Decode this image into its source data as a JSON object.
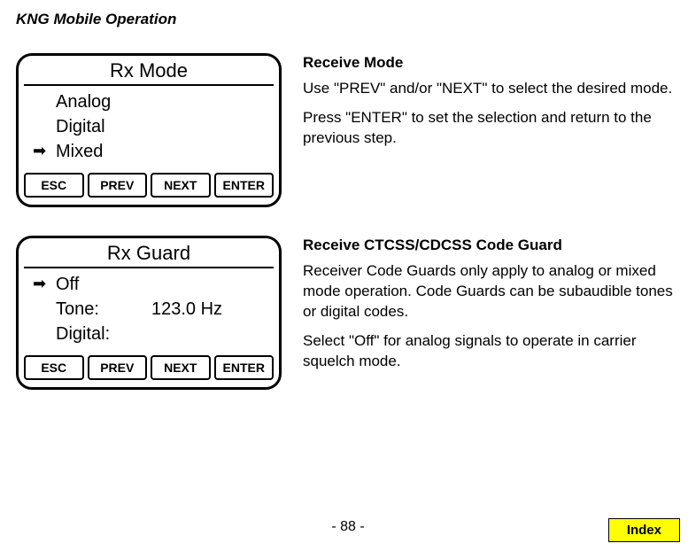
{
  "header": "KNG Mobile Operation",
  "section1": {
    "box": {
      "title": "Rx Mode",
      "items": [
        {
          "selected": false,
          "label": "Analog"
        },
        {
          "selected": false,
          "label": "Digital"
        },
        {
          "selected": true,
          "label": "Mixed"
        }
      ],
      "buttons": {
        "esc": "ESC",
        "prev": "PREV",
        "next": "NEXT",
        "enter": "ENTER"
      }
    },
    "desc": {
      "title": "Receive Mode",
      "p1": "Use \"PREV\" and/or \"NEXT\" to select the desired mode.",
      "p2": "Press \"ENTER\" to set the selection and return to the previous step."
    }
  },
  "section2": {
    "box": {
      "title": "Rx Guard",
      "items": [
        {
          "selected": true,
          "label": "Off",
          "value": ""
        },
        {
          "selected": false,
          "label": "Tone:",
          "value": "123.0 Hz"
        },
        {
          "selected": false,
          "label": "Digital:",
          "value": ""
        }
      ],
      "buttons": {
        "esc": "ESC",
        "prev": "PREV",
        "next": "NEXT",
        "enter": "ENTER"
      }
    },
    "desc": {
      "title": "Receive CTCSS/CDCSS Code Guard",
      "p1": "Receiver Code Guards only apply to analog or mixed mode operation. Code Guards can be subaudible tones or digital codes.",
      "p2": "Select \"Off\" for analog signals to operate in carrier squelch mode."
    }
  },
  "pageNumber": "- 88 -",
  "indexLabel": "Index",
  "arrowGlyph": "➡"
}
